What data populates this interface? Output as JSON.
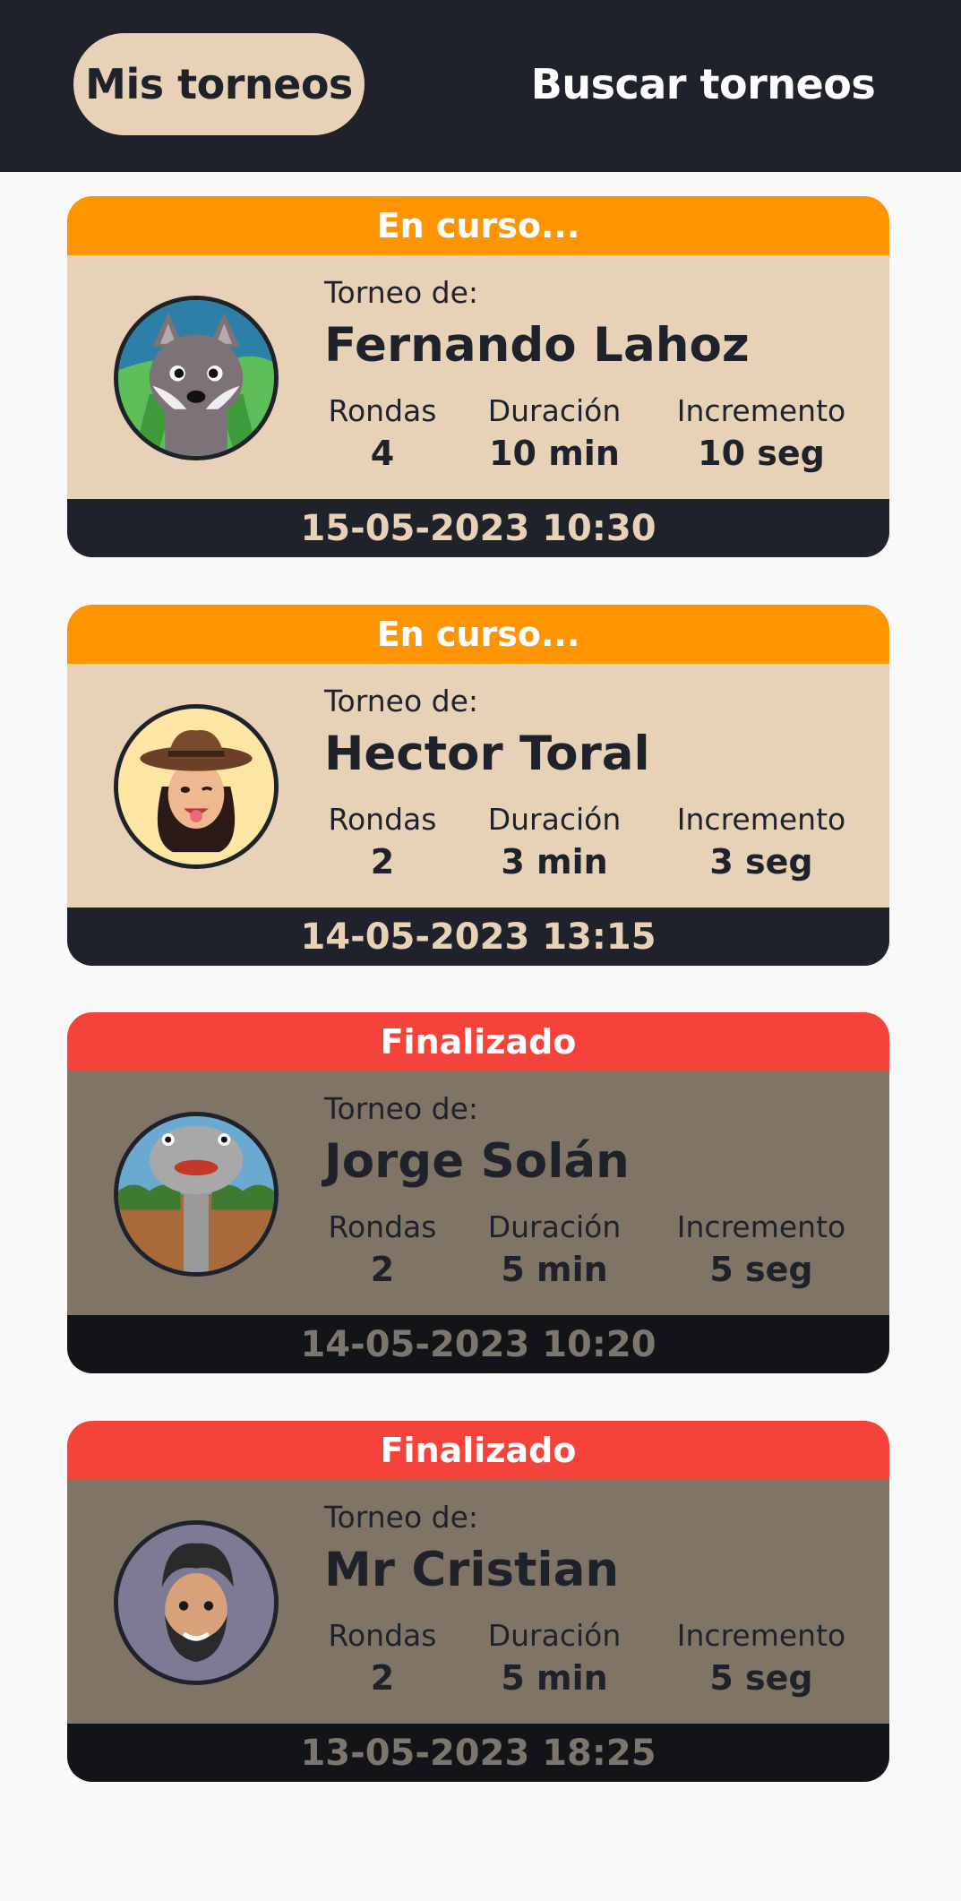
{
  "tabs": {
    "mine": "Mis torneos",
    "search": "Buscar torneos"
  },
  "labels": {
    "owner_prefix": "Torneo de:",
    "rounds": "Rondas",
    "duration": "Duración",
    "increment": "Incremento"
  },
  "tournaments": [
    {
      "status": "En curso...",
      "owner": "Fernando Lahoz",
      "avatar": "wolf-avatar-icon",
      "rounds": "4",
      "duration": "10 min",
      "increment": "10 seg",
      "datetime": "15-05-2023 10:30"
    },
    {
      "status": "En curso...",
      "owner": "Hector Toral",
      "avatar": "cowgirl-memoji-avatar",
      "rounds": "2",
      "duration": "3 min",
      "increment": "3 seg",
      "datetime": "14-05-2023 13:15"
    },
    {
      "status": "Finalizado",
      "owner": "Jorge Solán",
      "avatar": "ostrich-avatar-icon",
      "rounds": "2",
      "duration": "5 min",
      "increment": "5 seg",
      "datetime": "14-05-2023 10:20"
    },
    {
      "status": "Finalizado",
      "owner": "Mr Cristian",
      "avatar": "bearded-man-memoji-avatar",
      "rounds": "2",
      "duration": "5 min",
      "increment": "5 seg",
      "datetime": "13-05-2023 18:25"
    }
  ],
  "colors": {
    "dark": "#1f222a",
    "beige": "#e7d2b7",
    "ongoing": "#fe9500",
    "finished": "#f3433a",
    "finished_body": "#807467"
  }
}
